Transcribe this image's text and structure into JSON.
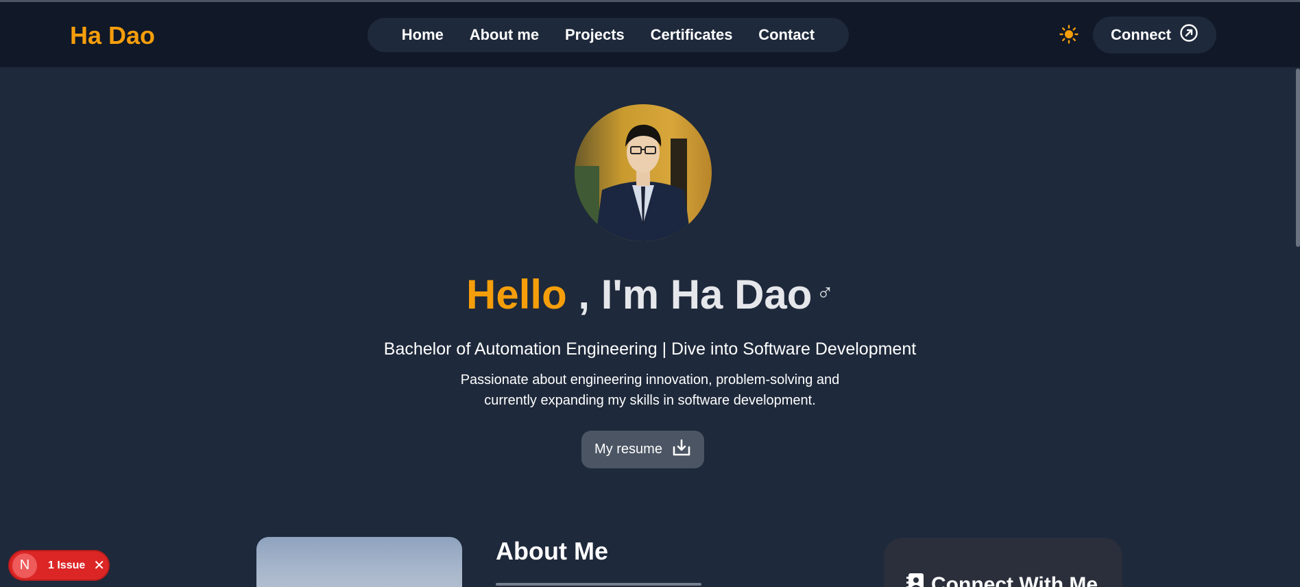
{
  "brand": {
    "name": "Ha Dao",
    "accent": "#f59e0b"
  },
  "nav": {
    "items": [
      {
        "label": "Home"
      },
      {
        "label": "About me"
      },
      {
        "label": "Projects"
      },
      {
        "label": "Certificates"
      },
      {
        "label": "Contact"
      }
    ],
    "theme_toggle_icon": "sun-icon",
    "connect_label": "Connect",
    "connect_icon": "arrow-up-right-circle-icon"
  },
  "hero": {
    "greeting_highlight": "Hello",
    "greeting_rest": ", I'm Ha Dao",
    "symbol": "♂",
    "subtitle": "Bachelor of Automation Engineering | Dive into Software Development",
    "description": "Passionate about engineering innovation, problem-solving and currently expanding my skills in software development.",
    "resume_label": "My resume",
    "resume_icon": "download-icon"
  },
  "about": {
    "title": "About Me"
  },
  "connect_card": {
    "title": "Connect With Me",
    "icon": "contact-book-icon"
  },
  "dev_overlay": {
    "logo_letter": "N",
    "issues_label": "1 Issue",
    "close_icon": "close-icon"
  },
  "colors": {
    "page_bg": "#1e293b",
    "navbar_bg": "#111827",
    "button_bg": "#4b5563",
    "issue_red": "#dc2626"
  }
}
